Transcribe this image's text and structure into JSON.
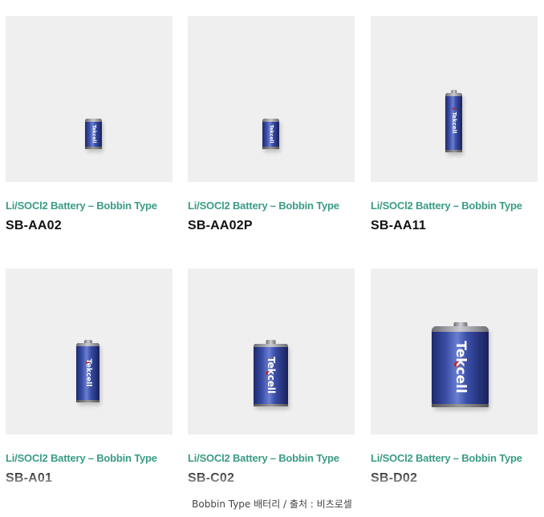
{
  "products": [
    {
      "category": "Li/SOCl2 Battery – Bobbin Type",
      "model": "SB-AA02",
      "battery_logo": "Tekcell"
    },
    {
      "category": "Li/SOCl2 Battery – Bobbin Type",
      "model": "SB-AA02P",
      "battery_logo": "Tekcell"
    },
    {
      "category": "Li/SOCl2 Battery – Bobbin Type",
      "model": "SB-AA11",
      "battery_logo": "Tekcell"
    },
    {
      "category": "Li/SOCl2 Battery – Bobbin Type",
      "model": "SB-A01",
      "battery_logo": "Tekcell"
    },
    {
      "category": "Li/SOCl2 Battery – Bobbin Type",
      "model": "SB-C02",
      "battery_logo": "Tekcell"
    },
    {
      "category": "Li/SOCl2 Battery – Bobbin Type",
      "model": "SB-D02",
      "battery_logo": "Tekcell"
    }
  ],
  "caption": "Bobbin Type 배터리 / 출처 : 비츠로셀",
  "colors": {
    "category_text": "#3a9c86",
    "model_text": "#111111",
    "photo_bg": "#efefef",
    "battery_body": "#3a4ea8"
  }
}
